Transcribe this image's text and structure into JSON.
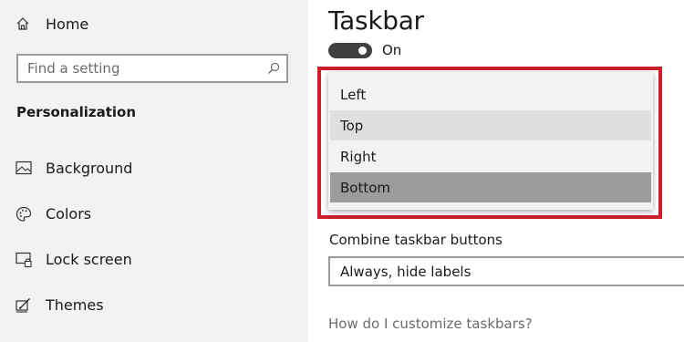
{
  "sidebar": {
    "home_label": "Home",
    "search_placeholder": "Find a setting",
    "section_title": "Personalization",
    "items": [
      {
        "label": "Background",
        "icon": "background-image-icon"
      },
      {
        "label": "Colors",
        "icon": "palette-icon"
      },
      {
        "label": "Lock screen",
        "icon": "lock-screen-icon"
      },
      {
        "label": "Themes",
        "icon": "themes-icon"
      }
    ]
  },
  "main": {
    "title": "Taskbar",
    "toggle_state": "On",
    "location_dropdown": {
      "options": [
        "Left",
        "Top",
        "Right",
        "Bottom"
      ],
      "hovered": "Top",
      "selected": "Bottom"
    },
    "combine_label": "Combine taskbar buttons",
    "combine_value": "Always, hide labels",
    "help_link": "How do I customize taskbars?"
  },
  "colors": {
    "sidebar_bg": "#f2f2f2",
    "highlight_frame": "#cc1f2b",
    "selected_option": "#9b9b9b",
    "hover_option": "#e0e0e0",
    "toggle_on": "#404040"
  }
}
